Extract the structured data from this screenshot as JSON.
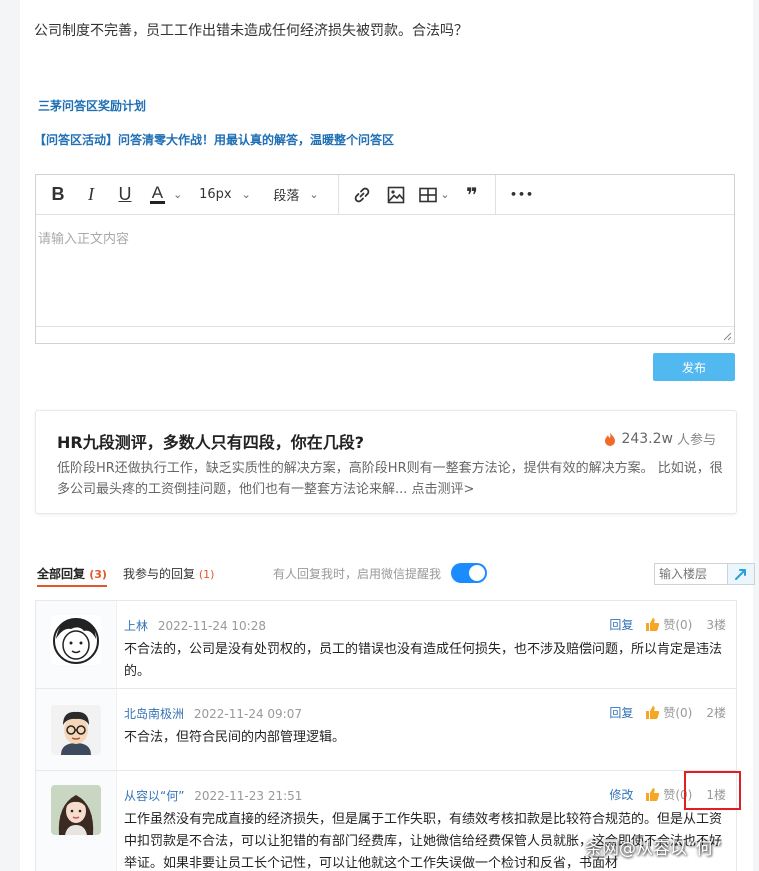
{
  "question": {
    "text": "公司制度不完善，员工工作出错未造成任何经济损失被罚款。合法吗？"
  },
  "links": {
    "plan": "三茅问答区奖励计划",
    "activity": "【问答区活动】问答清零大作战！用最认真的解答，温暖整个问答区"
  },
  "editor": {
    "bold": "B",
    "italic": "I",
    "underline": "U",
    "font_color": "A",
    "font_size": "16px",
    "paragraph": "段落",
    "quote": "❞",
    "more": "•••",
    "placeholder": "请输入正文内容"
  },
  "publish_label": "发布",
  "promo": {
    "title": "HR九段测评，多数人只有四段，你在几段?",
    "count": "243.2w",
    "count_suffix": "人参与",
    "desc": "低阶段HR还做执行工作，缺乏实质性的解决方案，高阶段HR则有一整套方法论，提供有效的解决方案。 比如说，很多公司最头疼的工资倒挂问题，他们也有一整套方法论来解... 点击测评>"
  },
  "tabs": {
    "all_label": "全部回复",
    "all_count": "(3)",
    "mine_label": "我参与的回复",
    "mine_count": "(1)",
    "notify_text": "有人回复我时，启用微信提醒我",
    "notify_on": true,
    "floor_placeholder": "输入楼层"
  },
  "replies": [
    {
      "author": "上林",
      "time": "2022-11-24 10:28",
      "action": "回复",
      "likes": "赞(0)",
      "floor": "3楼",
      "content": "不合法的，公司是没有处罚权的，员工的错误也没有造成任何损失，也不涉及赔偿问题，所以肯定是违法的。"
    },
    {
      "author": "北岛南极洲",
      "time": "2022-11-24 09:07",
      "action": "回复",
      "likes": "赞(0)",
      "floor": "2楼",
      "content": "不合法，但符合民间的内部管理逻辑。"
    },
    {
      "author": "从容以“何”",
      "time": "2022-11-23 21:51",
      "action": "修改",
      "likes": "赞(0)",
      "floor": "1楼",
      "content": "工作虽然没有完成直接的经济损失，但是属于工作失职，有绩效考核扣款是比较符合规范的。但是从工资中扣罚款是不合法，可以让犯错的有部门经费库，让她微信给经费保管人员就胀，这会即使不合法也不好举证。如果非要让员工长个记性，可以让他就这个工作失误做一个检讨和反省，书面材"
    }
  ],
  "watermark": "条网@从容以“何”",
  "colors": {
    "link": "#1f6fb5",
    "author": "#3574b6",
    "accent": "#e2582b",
    "publish": "#52b9f0",
    "toggle": "#1a8cff",
    "highlight": "#e02020"
  }
}
